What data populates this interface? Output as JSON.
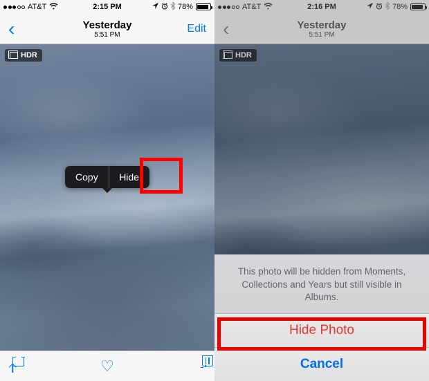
{
  "left": {
    "statusbar": {
      "carrier": "AT&T",
      "time": "2:15 PM",
      "battery_pct": "78%",
      "battery_level_width": "78%"
    },
    "navbar": {
      "title": "Yesterday",
      "subtitle": "5:51 PM",
      "edit": "Edit"
    },
    "hdr": "HDR",
    "menu": {
      "copy": "Copy",
      "hide": "Hide"
    }
  },
  "right": {
    "statusbar": {
      "carrier": "AT&T",
      "time": "2:16 PM",
      "battery_pct": "78%",
      "battery_level_width": "78%"
    },
    "navbar": {
      "title": "Yesterday",
      "subtitle": "5:51 PM"
    },
    "hdr": "HDR",
    "sheet": {
      "message": "This photo will be hidden from Moments, Collections and Years but still visible in Albums.",
      "hide_photo": "Hide Photo",
      "cancel": "Cancel"
    }
  }
}
